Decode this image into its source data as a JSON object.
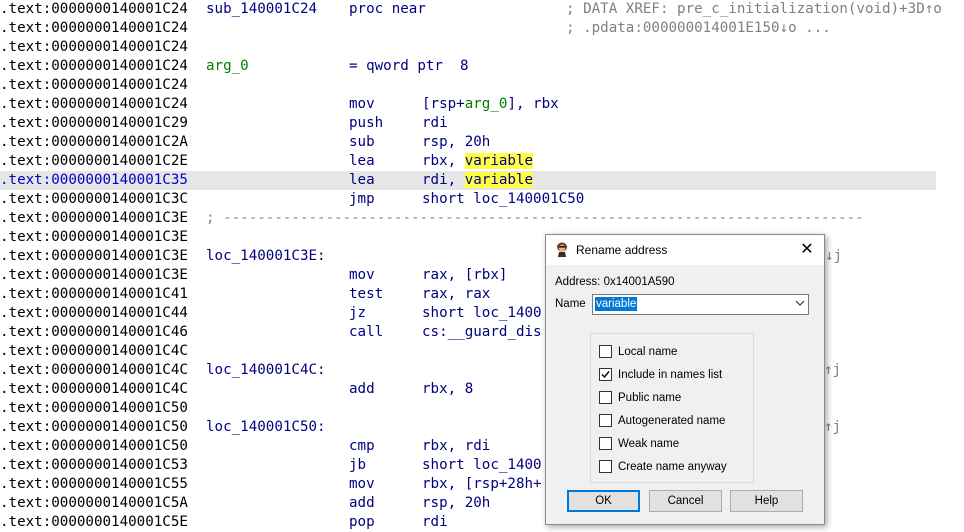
{
  "listing": {
    "lines": [
      {
        "addr": ".text:0000000140001C24",
        "label": "sub_140001C24",
        "mnem": "proc near",
        "op": "",
        "comment": "; DATA XREF: pre_c_initialization(void)+3D↑o"
      },
      {
        "addr": ".text:0000000140001C24",
        "label": "",
        "mnem": "",
        "op": "",
        "comment": "; .pdata:000000014001E150↓o ..."
      },
      {
        "addr": ".text:0000000140001C24",
        "label": "",
        "mnem": "",
        "op": "",
        "comment": ""
      },
      {
        "addr": ".text:0000000140001C24",
        "label": "arg_0",
        "mnem": "= qword ptr  8",
        "op": "",
        "comment": ""
      },
      {
        "addr": ".text:0000000140001C24",
        "label": "",
        "mnem": "",
        "op": "",
        "comment": ""
      },
      {
        "addr": ".text:0000000140001C24",
        "label": "",
        "mnem": "mov",
        "op_pre": "[rsp+",
        "op_arg": "arg_0",
        "op_post": "], rbx",
        "comment": ""
      },
      {
        "addr": ".text:0000000140001C29",
        "label": "",
        "mnem": "push",
        "op": "rdi",
        "comment": ""
      },
      {
        "addr": ".text:0000000140001C2A",
        "label": "",
        "mnem": "sub",
        "op": "rsp, 20h",
        "comment": ""
      },
      {
        "addr": ".text:0000000140001C2E",
        "label": "",
        "mnem": "lea",
        "op_pre": "rbx, ",
        "op_hl": "variable",
        "comment": ""
      },
      {
        "addr": ".text:0000000140001C35",
        "label": "",
        "mnem": "lea",
        "op_pre": "rdi, ",
        "op_hl": "variable",
        "comment": "",
        "selected": true
      },
      {
        "addr": ".text:0000000140001C3C",
        "label": "",
        "mnem": "jmp",
        "op": "short loc_140001C50",
        "comment": ""
      },
      {
        "addr": ".text:0000000140001C3E",
        "separator": "; ---------------------------------------------------------------------------"
      },
      {
        "addr": ".text:0000000140001C3E",
        "label": "",
        "mnem": "",
        "op": "",
        "comment": ""
      },
      {
        "addr": ".text:0000000140001C3E",
        "label": "loc_140001C3E:",
        "mnem": "",
        "op": "",
        "comment": "",
        "edge": "↓j"
      },
      {
        "addr": ".text:0000000140001C3E",
        "label": "",
        "mnem": "mov",
        "op": "rax, [rbx]",
        "comment": ""
      },
      {
        "addr": ".text:0000000140001C41",
        "label": "",
        "mnem": "test",
        "op": "rax, rax",
        "comment": ""
      },
      {
        "addr": ".text:0000000140001C44",
        "label": "",
        "mnem": "jz",
        "op": "short loc_1400",
        "comment": ""
      },
      {
        "addr": ".text:0000000140001C46",
        "label": "",
        "mnem": "call",
        "op": "cs:__guard_dis",
        "comment": ""
      },
      {
        "addr": ".text:0000000140001C4C",
        "label": "",
        "mnem": "",
        "op": "",
        "comment": ""
      },
      {
        "addr": ".text:0000000140001C4C",
        "label": "loc_140001C4C:",
        "mnem": "",
        "op": "",
        "comment": "",
        "edge": "↑j"
      },
      {
        "addr": ".text:0000000140001C4C",
        "label": "",
        "mnem": "add",
        "op": "rbx, 8",
        "comment": ""
      },
      {
        "addr": ".text:0000000140001C50",
        "label": "",
        "mnem": "",
        "op": "",
        "comment": ""
      },
      {
        "addr": ".text:0000000140001C50",
        "label": "loc_140001C50:",
        "mnem": "",
        "op": "",
        "comment": "",
        "edge": "↑j"
      },
      {
        "addr": ".text:0000000140001C50",
        "label": "",
        "mnem": "cmp",
        "op": "rbx, rdi",
        "comment": ""
      },
      {
        "addr": ".text:0000000140001C53",
        "label": "",
        "mnem": "jb",
        "op": "short loc_1400",
        "comment": ""
      },
      {
        "addr": ".text:0000000140001C55",
        "label": "",
        "mnem": "mov",
        "op": "rbx, [rsp+28h+",
        "comment": ""
      },
      {
        "addr": ".text:0000000140001C5A",
        "label": "",
        "mnem": "add",
        "op": "rsp, 20h",
        "comment": ""
      },
      {
        "addr": ".text:0000000140001C5E",
        "label": "",
        "mnem": "pop",
        "op": "rdi",
        "comment": ""
      }
    ]
  },
  "dialog": {
    "title": "Rename address",
    "close_glyph": "✕",
    "address_label": "Address:",
    "address_value": "0x14001A590",
    "name_label": "Name",
    "name_value": "variable",
    "options": [
      {
        "label": "Local name",
        "checked": false
      },
      {
        "label": "Include in names list",
        "checked": true
      },
      {
        "label": "Public name",
        "checked": false
      },
      {
        "label": "Autogenerated name",
        "checked": false
      },
      {
        "label": "Weak name",
        "checked": false
      },
      {
        "label": "Create name anyway",
        "checked": false
      }
    ],
    "ok_label": "OK",
    "cancel_label": "Cancel",
    "help_label": "Help"
  },
  "colors": {
    "highlight": "#ffff44",
    "selection_line": "#e6e6e6",
    "code": "#000080",
    "comment": "#808080",
    "argname": "#008000"
  },
  "icons": {
    "title": "ida-app-icon",
    "combo": "chevron-down-icon",
    "check": "checkmark-icon"
  }
}
